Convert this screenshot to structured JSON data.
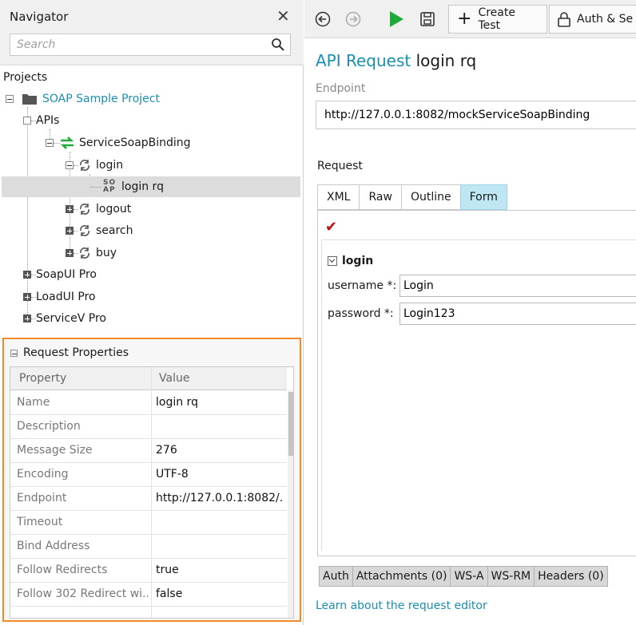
{
  "navigator": {
    "title": "Navigator",
    "search_placeholder": "Search",
    "projects_label": "Projects",
    "tree": {
      "project": "SOAP Sample Project",
      "apis": "APIs",
      "binding": "ServiceSoapBinding",
      "login": "login",
      "login_rq_badge": "SO AP",
      "login_rq": "login rq",
      "logout": "logout",
      "search": "search",
      "buy": "buy",
      "soapui_pro": "SoapUI Pro",
      "loadui_pro": "LoadUI Pro",
      "servicev_pro": "ServiceV Pro"
    }
  },
  "request_properties": {
    "title": "Request Properties",
    "col_property": "Property",
    "col_value": "Value",
    "rows": [
      {
        "k": "Name",
        "v": "login rq"
      },
      {
        "k": "Description",
        "v": ""
      },
      {
        "k": "Message Size",
        "v": "276"
      },
      {
        "k": "Encoding",
        "v": "UTF-8"
      },
      {
        "k": "Endpoint",
        "v": "http://127.0.0.1:8082/..."
      },
      {
        "k": "Timeout",
        "v": ""
      },
      {
        "k": "Bind Address",
        "v": ""
      },
      {
        "k": "Follow Redirects",
        "v": "true"
      },
      {
        "k": "Follow 302 Redirect wi...",
        "v": "false"
      }
    ]
  },
  "editor": {
    "create_test": "Create Test",
    "auth_security": "Auth & Se",
    "title_prefix": "API Request",
    "title_name": "login rq",
    "endpoint_label": "Endpoint",
    "endpoint_value": "http://127.0.0.1:8082/mockServiceSoapBinding",
    "request_label": "Request",
    "tabs": [
      "XML",
      "Raw",
      "Outline",
      "Form"
    ],
    "form": {
      "section": "login",
      "username_label": "username *:",
      "username_value": "Login",
      "password_label": "password *:",
      "password_value": "Login123"
    },
    "bottom_tabs": [
      "Auth",
      "Attachments (0)",
      "WS-A",
      "WS-RM",
      "Headers (0)"
    ],
    "learn_link": "Learn about the request editor"
  },
  "colors": {
    "accent_blue": "#1a8fb0",
    "highlight_orange": "#f08a24",
    "run_green": "#1faa3a",
    "active_tab": "#bfe6f3"
  }
}
